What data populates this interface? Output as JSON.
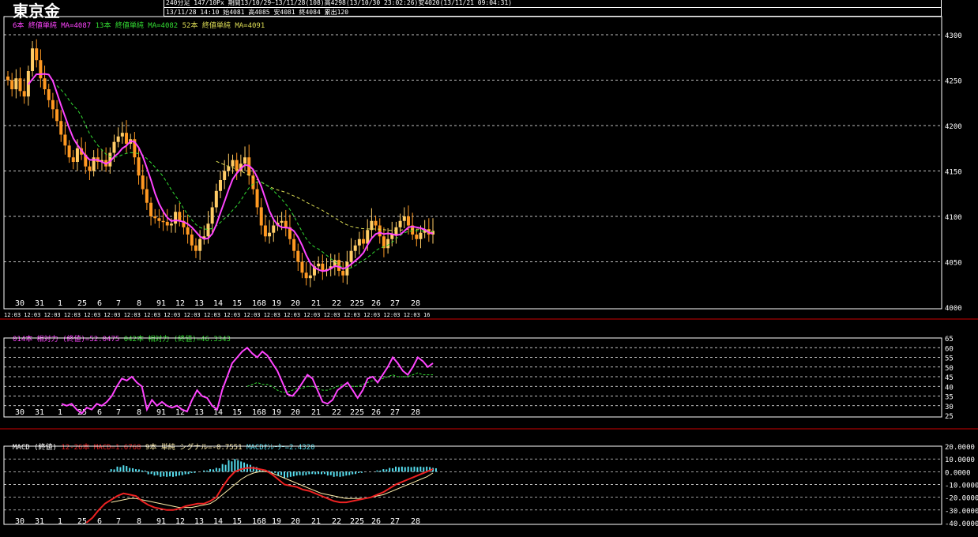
{
  "header": {
    "instrument": "東京金",
    "info_line1": "240分足 147/10Px 期間13/10/29~13/11/28(108)高4298(13/10/30 23:02:26)安4020(13/11/21 09:04:31)",
    "info_line2": "13/11/28 14:10 始4081 高4085 安4081 終4084 累出120"
  },
  "colors": {
    "background": "#000000",
    "up_candle": "#ffcc66",
    "down_candle": "#ff9922",
    "ma_short": "#ff44ff",
    "ma_mid": "#33dd33",
    "ma_long": "#dddd55",
    "macd": "#ee2222",
    "signal": "#ffeeaa",
    "histogram": "#55ddee",
    "grid": "#ffffff",
    "separator": "#cc0000"
  },
  "date_labels": [
    "30",
    "31",
    "1",
    "25",
    "6",
    "7",
    "8",
    "91",
    "12",
    "13",
    "14",
    "15",
    "168",
    "19",
    "20",
    "21",
    "22",
    "225",
    "26",
    "27",
    "28"
  ],
  "bottom_time_text": "12:03 12:03 12:03 12:03 12:03 12:03 12:03 12:03 12:03 12:03 12:03 12:03 12:03 12:03 12:03 12:03 12:03 12:03 12:03 12:03 12:03 16",
  "price_panel": {
    "legend": [
      {
        "text": "6本 終値単純 MA=4087",
        "color": "#ff44ff"
      },
      {
        "text": "13本 終値単純 MA=4082",
        "color": "#33dd33"
      },
      {
        "text": "52本 終値単純 MA=4091",
        "color": "#dddd55"
      }
    ]
  },
  "rsi_panel": {
    "legend": [
      {
        "text": "014本 相対力 (終値)=52.0475",
        "color": "#ff44ff"
      },
      {
        "text": "042本 相対力 (終値)=46.3343",
        "color": "#33dd33"
      }
    ]
  },
  "macd_panel": {
    "legend": [
      {
        "text": "MACD (終値)",
        "color": "#ffffff"
      },
      {
        "text": "12-26本 MACD=1.6768",
        "color": "#ee2222"
      },
      {
        "text": "9本 単純 シグナル=-0.7551",
        "color": "#ffeeaa"
      },
      {
        "text": "MACDｵｼﾚｰﾀｰ=2.4320",
        "color": "#55ddee"
      }
    ]
  },
  "chart_data": [
    {
      "type": "candlestick",
      "title": "東京金",
      "ylim": [
        4000,
        4300
      ],
      "yticks": [
        4000,
        4050,
        4100,
        4150,
        4200,
        4250,
        4300
      ],
      "closes": [
        4250,
        4240,
        4252,
        4238,
        4232,
        4260,
        4285,
        4272,
        4252,
        4240,
        4228,
        4218,
        4205,
        4190,
        4178,
        4165,
        4160,
        4175,
        4168,
        4155,
        4150,
        4165,
        4160,
        4162,
        4155,
        4170,
        4182,
        4188,
        4192,
        4180,
        4185,
        4165,
        4145,
        4130,
        4115,
        4100,
        4098,
        4095,
        4094,
        4090,
        4092,
        4105,
        4095,
        4088,
        4080,
        4068,
        4062,
        4075,
        4078,
        4092,
        4110,
        4128,
        4140,
        4150,
        4155,
        4162,
        4150,
        4158,
        4165,
        4145,
        4130,
        4110,
        4090,
        4078,
        4082,
        4090,
        4093,
        4095,
        4088,
        4075,
        4062,
        4050,
        4038,
        4032,
        4035,
        4045,
        4048,
        4040,
        4042,
        4045,
        4052,
        4040,
        4035,
        4050,
        4062,
        4068,
        4075,
        4070,
        4085,
        4095,
        4090,
        4078,
        4065,
        4075,
        4080,
        4088,
        4095,
        4100,
        4090,
        4080,
        4075,
        4082,
        4086,
        4080,
        4084
      ]
    },
    {
      "type": "line",
      "title": "相対力",
      "ylim": [
        25,
        65
      ],
      "yticks": [
        25,
        30,
        35,
        40,
        45,
        50,
        55,
        60,
        65
      ],
      "series": [
        {
          "name": "014本 相対力 (終値)",
          "values": [
            31,
            30,
            31,
            28,
            26,
            29,
            28,
            31,
            30,
            32,
            35,
            40,
            44,
            43,
            45,
            42,
            40,
            28,
            33,
            30,
            32,
            30,
            29,
            30,
            28,
            27,
            33,
            38,
            35,
            34,
            30,
            28,
            38,
            45,
            52,
            55,
            58,
            60,
            57,
            55,
            58,
            56,
            52,
            48,
            42,
            36,
            35,
            38,
            42,
            46,
            44,
            38,
            32,
            31,
            33,
            38,
            40,
            42,
            38,
            34,
            38,
            44,
            45,
            42,
            46,
            50,
            55,
            52,
            48,
            46,
            50,
            55,
            53,
            50,
            52
          ]
        },
        {
          "name": "042本 相対力 (終値)",
          "values": [
            null,
            null,
            null,
            null,
            null,
            null,
            null,
            null,
            null,
            null,
            null,
            null,
            null,
            null,
            null,
            null,
            null,
            null,
            null,
            null,
            null,
            null,
            null,
            null,
            null,
            null,
            null,
            null,
            null,
            null,
            null,
            null,
            null,
            null,
            null,
            null,
            null,
            40,
            41,
            42,
            41,
            41,
            40,
            38,
            37,
            37,
            38,
            39,
            39,
            40,
            40,
            39,
            38,
            38,
            39,
            40,
            41,
            41,
            40,
            40,
            41,
            42,
            43,
            43,
            44,
            45,
            46,
            45,
            45,
            45,
            46,
            47,
            46,
            46,
            46
          ]
        }
      ]
    },
    {
      "type": "line",
      "title": "MACD (終値)",
      "ylim": [
        -40,
        20
      ],
      "yticks": [
        20,
        10,
        0,
        -10,
        -20,
        -30,
        -40
      ],
      "series": [
        {
          "name": "MACD",
          "values": [
            null,
            null,
            null,
            null,
            -40,
            -36,
            -30,
            -25,
            -22,
            -19,
            -17,
            -18,
            -19,
            -23,
            -26,
            -28,
            -29,
            -30,
            -30,
            -29,
            -27,
            -26,
            -25,
            -25,
            -23,
            -20,
            -12,
            -5,
            0,
            2,
            3,
            3,
            2,
            1,
            -2,
            -6,
            -10,
            -11,
            -12,
            -14,
            -15,
            -17,
            -19,
            -21,
            -23,
            -24,
            -24,
            -23,
            -22,
            -21,
            -20,
            -18,
            -16,
            -13,
            -10,
            -8,
            -6,
            -4,
            -2,
            0,
            2
          ]
        },
        {
          "name": "シグナル",
          "values": [
            null,
            null,
            null,
            null,
            null,
            null,
            null,
            null,
            -24,
            -23,
            -22,
            -21,
            -21,
            -22,
            -23,
            -24,
            -25,
            -26,
            -27,
            -28,
            -28,
            -28,
            -27,
            -26,
            -25,
            -22,
            -18,
            -14,
            -10,
            -6,
            -3,
            -1,
            0,
            0,
            -1,
            -3,
            -5,
            -7,
            -9,
            -11,
            -13,
            -15,
            -17,
            -18,
            -19,
            -20,
            -21,
            -21,
            -21,
            -21,
            -20,
            -19,
            -18,
            -16,
            -14,
            -12,
            -10,
            -8,
            -6,
            -4,
            -1
          ]
        },
        {
          "name": "MACDｵｼﾚｰﾀｰ",
          "values": [
            null,
            null,
            null,
            null,
            null,
            null,
            null,
            null,
            2,
            4,
            5,
            3,
            2,
            1,
            -2,
            -3,
            -4,
            -4,
            -4,
            -3,
            -2,
            -1,
            0,
            1,
            2,
            3,
            6,
            9,
            10,
            8,
            6,
            4,
            2,
            1,
            -1,
            -3,
            -5,
            -4,
            -3,
            -3,
            -2,
            -2,
            -2,
            -3,
            -4,
            -4,
            -3,
            -2,
            -1,
            0,
            0,
            1,
            2,
            3,
            4,
            4,
            4,
            4,
            4,
            4,
            3
          ]
        }
      ]
    }
  ]
}
